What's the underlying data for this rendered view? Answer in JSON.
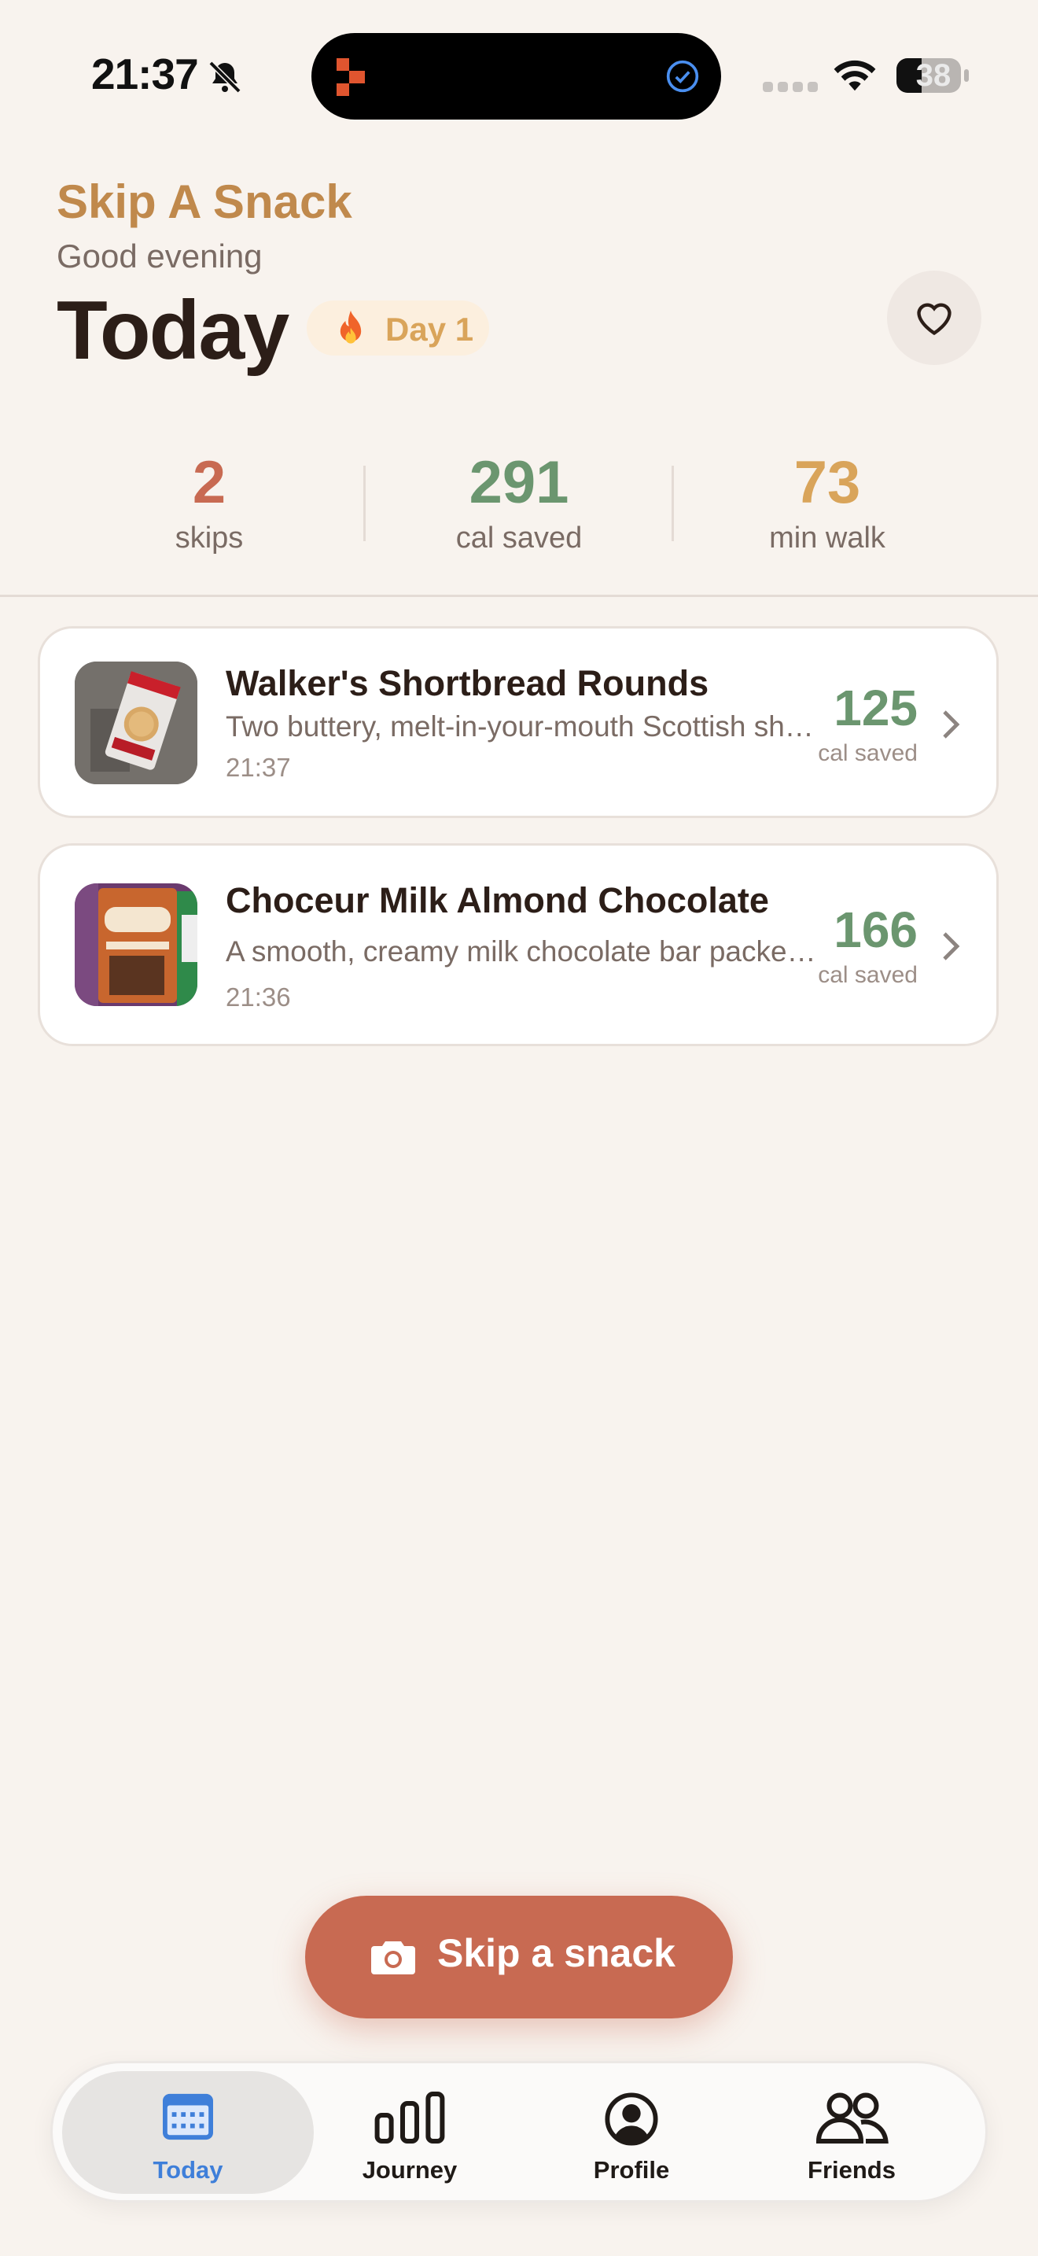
{
  "status_bar": {
    "time": "21:37",
    "battery": "38",
    "icons": [
      "bell-slash-icon",
      "app-icon",
      "check-circle-icon",
      "signal-icon",
      "wifi-icon",
      "battery-icon"
    ]
  },
  "header": {
    "app_title": "Skip A Snack",
    "greeting": "Good evening",
    "title": "Today",
    "streak_badge": "Day 1",
    "streak_icon": "fire-icon",
    "favorite_icon": "heart-icon"
  },
  "stats": [
    {
      "value": "2",
      "label": "skips",
      "color": "#c86a52"
    },
    {
      "value": "291",
      "label": "cal saved",
      "color": "#6b966f"
    },
    {
      "value": "73",
      "label": "min walk",
      "color": "#d9a45a"
    }
  ],
  "skips": [
    {
      "name": "Walker's Shortbread Rounds",
      "description": "Two buttery, melt-in-your-mouth Scottish shortbread rounds",
      "time": "21:37",
      "calories": "125",
      "calories_label": "cal saved"
    },
    {
      "name": "Choceur Milk Almond Chocolate",
      "description": "A smooth, creamy milk chocolate bar packed with almonds",
      "time": "21:36",
      "calories": "166",
      "calories_label": "cal saved"
    }
  ],
  "cta": {
    "label": "Skip a snack",
    "icon": "camera-icon"
  },
  "tabs": [
    {
      "label": "Today",
      "icon": "calendar-icon",
      "active": true
    },
    {
      "label": "Journey",
      "icon": "bar-chart-icon",
      "active": false
    },
    {
      "label": "Profile",
      "icon": "person-circle-icon",
      "active": false
    },
    {
      "label": "Friends",
      "icon": "people-icon",
      "active": false
    }
  ],
  "colors": {
    "background": "#f8f3ee",
    "accent": "#c86a52",
    "gold": "#c0894c",
    "green": "#6b966f",
    "tab_active": "#3f7fd9"
  }
}
